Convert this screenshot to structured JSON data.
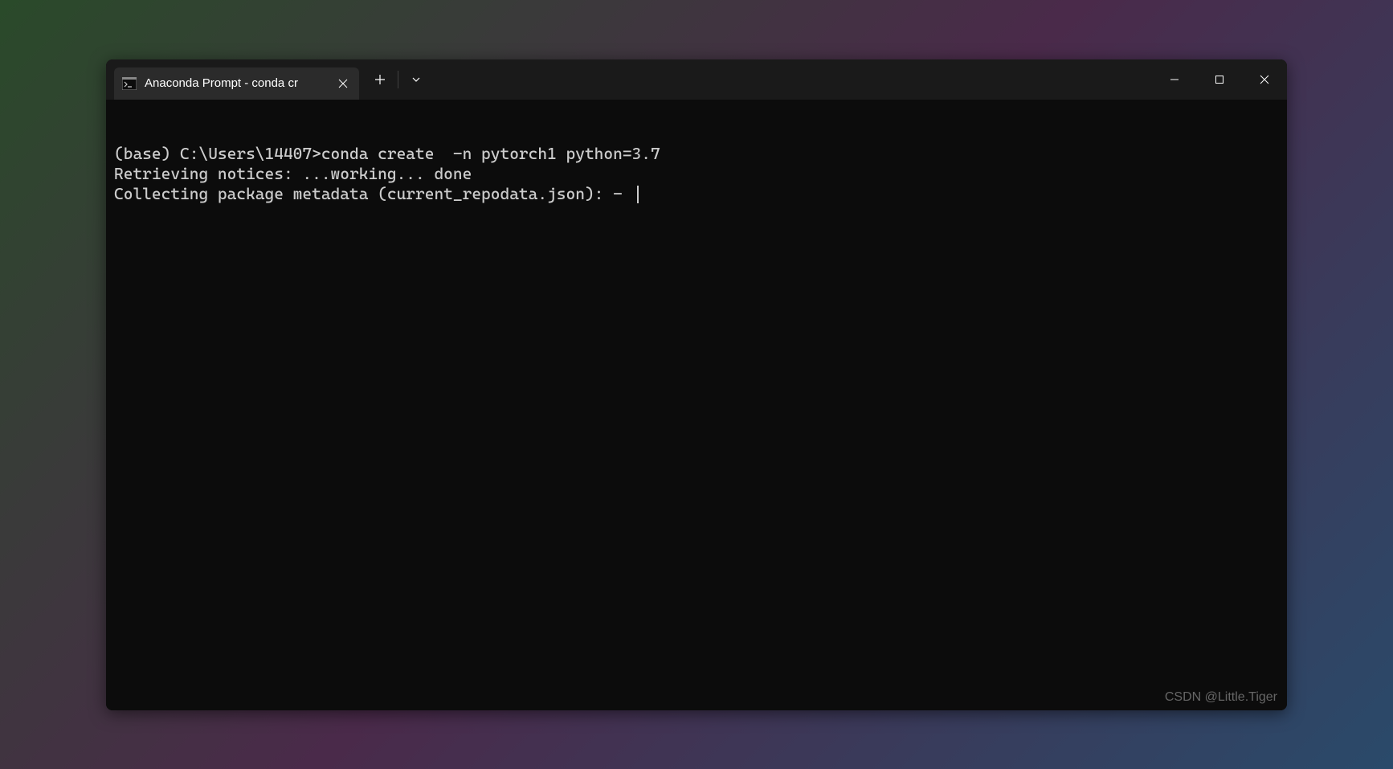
{
  "window": {
    "tab_title": "Anaconda Prompt - conda  cr"
  },
  "terminal": {
    "line1": "(base) C:\\Users\\14407>conda create  -n pytorch1 python=3.7",
    "line2": "Retrieving notices: ...working... done",
    "line3": "Collecting package metadata (current_repodata.json): - "
  },
  "watermark": "CSDN @Little.Tiger"
}
